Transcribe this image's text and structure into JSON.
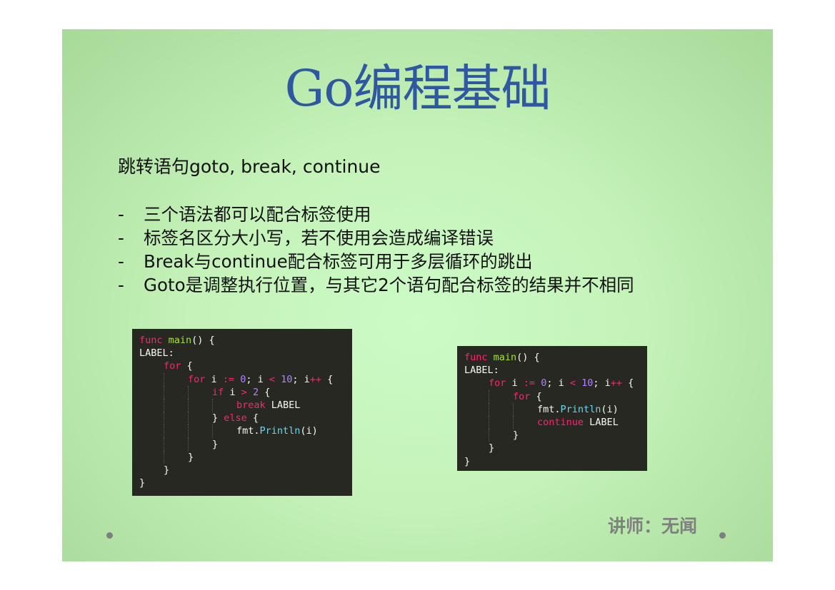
{
  "slide": {
    "title": "Go编程基础",
    "subtitle": "跳转语句goto, break, continue",
    "bullets": [
      {
        "dash": "-",
        "text": "三个语法都可以配合标签使用"
      },
      {
        "dash": "-",
        "text": "标签名区分大小写，若不使用会造成编译错误"
      },
      {
        "dash": "-",
        "text": "Break与continue配合标签可用于多层循环的跳出"
      },
      {
        "dash": "-",
        "text": "Goto是调整执行位置，与其它2个语句配合标签的结果并不相同"
      }
    ],
    "instructor": "讲师：无闻",
    "colors": {
      "title": "#2f58a0",
      "keyword": "#f92672",
      "function": "#a6e22e",
      "number": "#ae81ff",
      "builtin": "#66d9ef",
      "code_bg": "#272822"
    }
  },
  "code_left": {
    "lines": [
      "func main() {",
      "LABEL:",
      "for {",
      "for i := 0; i < 10; i++ {",
      "if i > 2 {",
      "break LABEL",
      "} else {",
      "fmt.Println(i)",
      "}",
      "}",
      "}",
      "}"
    ]
  },
  "code_right": {
    "lines": [
      "func main() {",
      "LABEL:",
      "for i := 0; i < 10; i++ {",
      "for {",
      "fmt.Println(i)",
      "continue LABEL",
      "}",
      "}",
      "}"
    ]
  }
}
